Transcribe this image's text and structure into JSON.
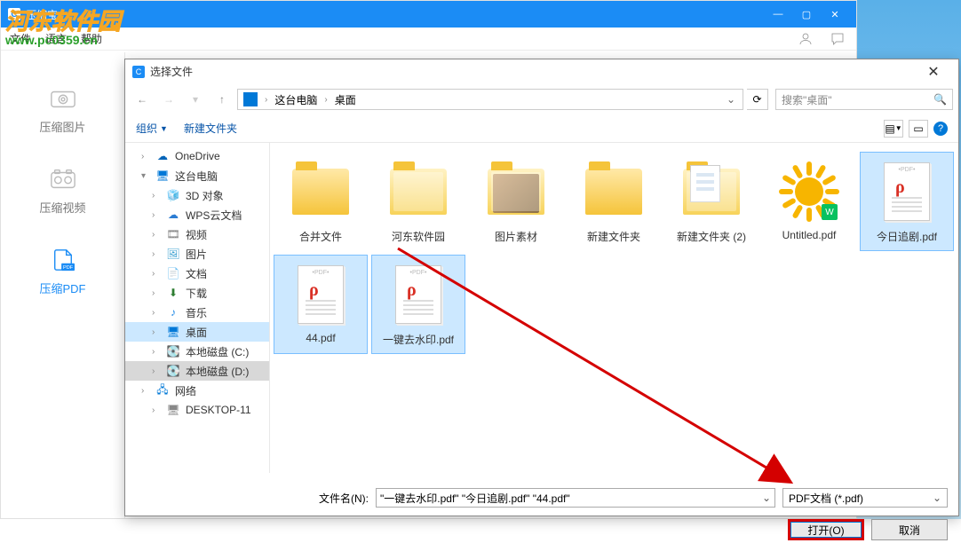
{
  "app": {
    "title": "压缩宝",
    "menu": {
      "file": "文件",
      "lang": "语言",
      "help": "帮助"
    }
  },
  "watermark": {
    "line1a": "河东",
    "line1b": "软件园",
    "line2": "www.pc0359.cn"
  },
  "sidebar": {
    "items": [
      {
        "label": "压缩图片",
        "name": "compress-image"
      },
      {
        "label": "压缩视频",
        "name": "compress-video"
      },
      {
        "label": "压缩PDF",
        "name": "compress-pdf",
        "active": true
      }
    ]
  },
  "dialog": {
    "title": "选择文件",
    "breadcrumb": {
      "parts": [
        "这台电脑",
        "桌面"
      ]
    },
    "search_placeholder": "搜索\"桌面\"",
    "toolbar": {
      "organize": "组织",
      "newfolder": "新建文件夹"
    },
    "tree": [
      {
        "label": "OneDrive",
        "icon": "cloud",
        "color": "#0364b8",
        "lvl": 1
      },
      {
        "label": "这台电脑",
        "icon": "pc",
        "color": "#0078d7",
        "lvl": 1,
        "exp": "▾"
      },
      {
        "label": "3D 对象",
        "icon": "cube",
        "color": "#0078d7",
        "lvl": 2
      },
      {
        "label": "WPS云文档",
        "icon": "cloud",
        "color": "#2b7cd3",
        "lvl": 2
      },
      {
        "label": "视频",
        "icon": "video",
        "color": "#7b7b7b",
        "lvl": 2
      },
      {
        "label": "图片",
        "icon": "image",
        "color": "#3aa0d1",
        "lvl": 2
      },
      {
        "label": "文档",
        "icon": "doc",
        "color": "#7b7b7b",
        "lvl": 2
      },
      {
        "label": "下载",
        "icon": "download",
        "color": "#2e7d32",
        "lvl": 2
      },
      {
        "label": "音乐",
        "icon": "music",
        "color": "#1e88e5",
        "lvl": 2
      },
      {
        "label": "桌面",
        "icon": "desktop",
        "color": "#0078d7",
        "lvl": 2,
        "sel": true
      },
      {
        "label": "本地磁盘 (C:)",
        "icon": "disk",
        "color": "#888",
        "lvl": 2
      },
      {
        "label": "本地磁盘 (D:)",
        "icon": "disk",
        "color": "#888",
        "lvl": 2,
        "sel2": true
      },
      {
        "label": "网络",
        "icon": "net",
        "color": "#0078d7",
        "lvl": 1
      },
      {
        "label": "DESKTOP-11",
        "icon": "pc",
        "color": "#888",
        "lvl": 2
      }
    ],
    "files": [
      {
        "label": "合并文件",
        "type": "folder"
      },
      {
        "label": "河东软件园",
        "type": "folder-open"
      },
      {
        "label": "图片素材",
        "type": "folder-img"
      },
      {
        "label": "新建文件夹",
        "type": "folder"
      },
      {
        "label": "新建文件夹 (2)",
        "type": "folder-doc"
      },
      {
        "label": "Untitled.pdf",
        "type": "sun"
      },
      {
        "label": "今日追剧.pdf",
        "type": "pdf",
        "selected": true
      },
      {
        "label": "44.pdf",
        "type": "pdf",
        "selected": true
      },
      {
        "label": "一键去水印.pdf",
        "type": "pdf",
        "selected": true
      }
    ],
    "footer": {
      "name_label": "文件名(N):",
      "name_value": "\"一键去水印.pdf\" \"今日追剧.pdf\" \"44.pdf\"",
      "filter": "PDF文档 (*.pdf)",
      "open": "打开(O)",
      "cancel": "取消"
    }
  }
}
